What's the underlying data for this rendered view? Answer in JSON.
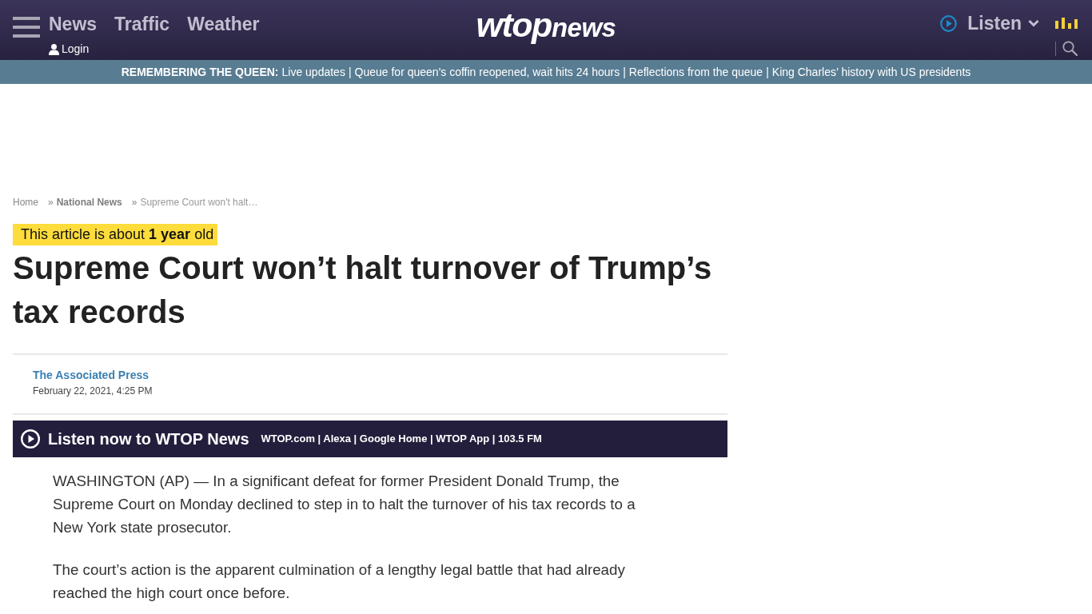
{
  "header": {
    "nav_links": [
      "News",
      "Traffic",
      "Weather"
    ],
    "login": "Login",
    "logo": {
      "heavy_part": "wtop",
      "light_part": "news"
    },
    "listen": "Listen"
  },
  "ticker": {
    "heading": "REMEMBERING THE QUEEN:",
    "separator": "|",
    "links": [
      "Live updates",
      "Queue for queen's coffin reopened, wait hits 24 hours",
      "Reflections from the queue",
      "King Charles’ history with US presidents"
    ]
  },
  "breadcrumb": {
    "separator": "»",
    "items": [
      {
        "label": "Home",
        "kind": "link"
      },
      {
        "label": "National News",
        "kind": "section"
      },
      {
        "label": "Supreme Court won't halt…",
        "kind": "current"
      }
    ]
  },
  "age_notice": "This article is about **1 year** old",
  "headline": "Supreme Court won’t halt turnover of Trump’s tax records",
  "byline": {
    "author": "The Associated Press",
    "date": "February 22, 2021, 4:25 PM"
  },
  "listen_banner": {
    "title": "Listen now to WTOP News",
    "platforms": "WTOP.com | Alexa | Google Home | WTOP App | 103.5 FM"
  },
  "paragraphs": [
    "WASHINGTON (AP) — In a significant defeat for former President Donald Trump, the Supreme Court on Monday declined to step in to halt the turnover of his tax records to a New York state prosecutor.",
    "The court’s action is the apparent culmination of a lengthy legal battle that had already reached the high court once before."
  ]
}
